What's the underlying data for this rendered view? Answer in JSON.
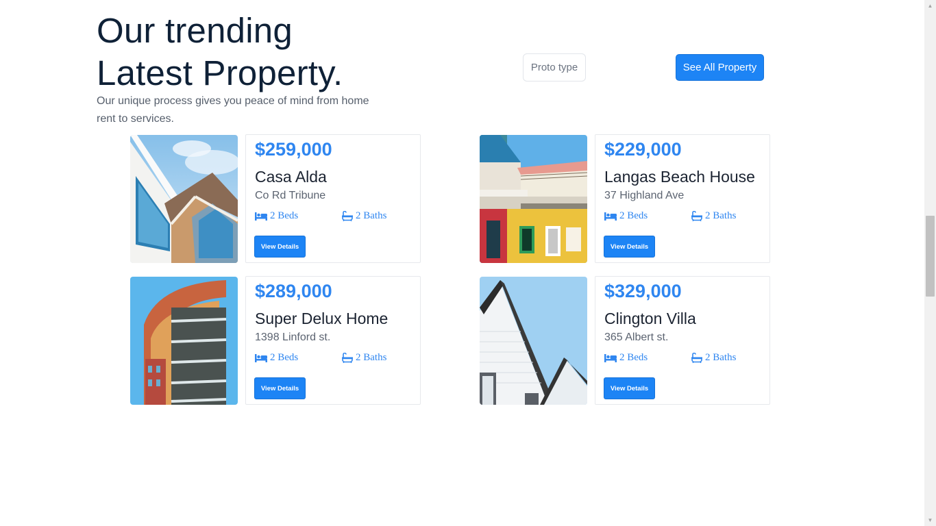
{
  "header": {
    "title_line1": "Our trending",
    "title_line2": "Latest Property.",
    "subtitle": "Our unique process gives you peace of mind from home rent to services."
  },
  "controls": {
    "type_select_value": "Proto type",
    "see_all_label": "See All Property"
  },
  "colors": {
    "accent": "#1d84f5",
    "price": "#2f86f0",
    "heading": "#0f2137"
  },
  "icons": {
    "beds": "bed-icon",
    "baths": "bathtub-icon"
  },
  "properties": [
    {
      "price": "$259,000",
      "name": "Casa Alda",
      "address": "Co Rd Tribune",
      "beds": "2 Beds",
      "baths": "2 Baths",
      "button": "View Details"
    },
    {
      "price": "$229,000",
      "name": "Langas Beach House",
      "address": "37 Highland Ave",
      "beds": "2 Beds",
      "baths": "2 Baths",
      "button": "View Details"
    },
    {
      "price": "$289,000",
      "name": "Super Delux Home",
      "address": "1398 Linford st.",
      "beds": "2 Beds",
      "baths": "2 Baths",
      "button": "View Details"
    },
    {
      "price": "$329,000",
      "name": "Clington Villa",
      "address": "365 Albert st.",
      "beds": "2 Beds",
      "baths": "2 Baths",
      "button": "View Details"
    }
  ]
}
